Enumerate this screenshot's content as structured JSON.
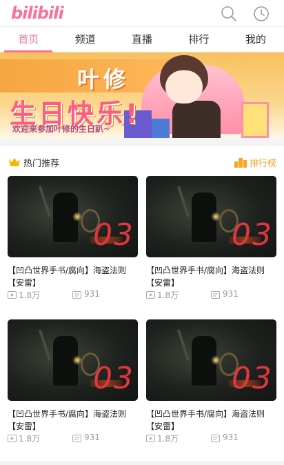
{
  "header": {
    "logo": "bilibili",
    "icons": [
      "search-icon",
      "history-clock-icon"
    ]
  },
  "tabs": [
    {
      "label": "首页",
      "active": true
    },
    {
      "label": "频道",
      "active": false
    },
    {
      "label": "直播",
      "active": false
    },
    {
      "label": "排行",
      "active": false
    },
    {
      "label": "我的",
      "active": false
    }
  ],
  "banner": {
    "title_line1": "叶修",
    "title_line2": "生日快乐!",
    "subtitle": "欢迎来参加叶修的生日趴~"
  },
  "section": {
    "title": "热门推荐",
    "rank_link": "排行榜",
    "icons": [
      "crown-icon",
      "ranking-icon"
    ]
  },
  "videos": [
    {
      "title": "【凹凸世界手书/腐向】海盗法则【安雷】",
      "plays": "1.8万",
      "danmaku": "931",
      "overlay": "03"
    },
    {
      "title": "【凹凸世界手书/腐向】海盗法则【安雷】",
      "plays": "1.8万",
      "danmaku": "931",
      "overlay": "03"
    },
    {
      "title": "【凹凸世界手书/腐向】海盗法则【安雷】",
      "plays": "1.8万",
      "danmaku": "931",
      "overlay": "03"
    },
    {
      "title": "【凹凸世界手书/腐向】海盗法则【安雷】",
      "plays": "1.8万",
      "danmaku": "931",
      "overlay": "03"
    }
  ],
  "colors": {
    "brand_pink": "#fb7299",
    "rank_orange": "#f5a623",
    "meta_gray": "#999999"
  }
}
